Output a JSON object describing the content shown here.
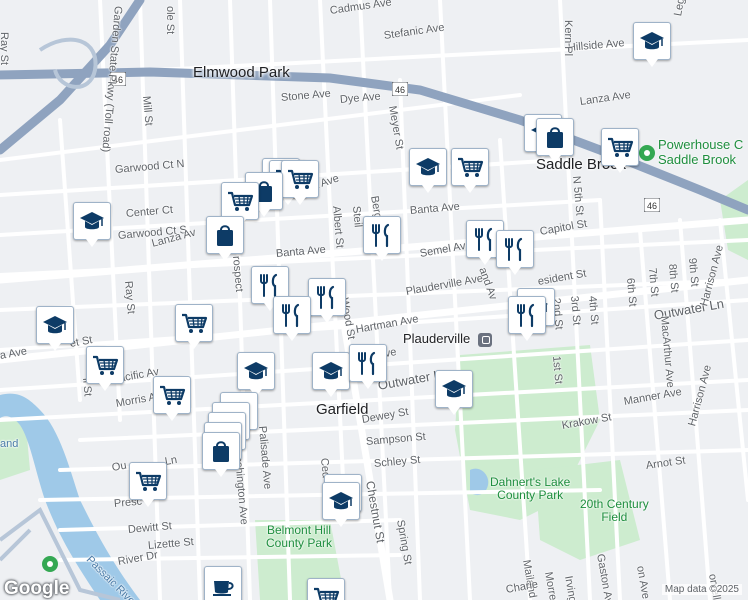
{
  "map": {
    "places": {
      "elmwood_park": "Elmwood Park",
      "saddle_brook": "Saddle Brook",
      "garfield": "Garfield",
      "plauderville": "Plauderville"
    },
    "parks": {
      "belmont_hill": "Belmont Hill\nCounty Park",
      "dahnerts_lake": "Dahnert's Lake\nCounty Park",
      "twentieth_century": "20th Century\nField"
    },
    "poi": {
      "powerhouse": "Powerhouse C\nSaddle Brook"
    },
    "route_number": "46",
    "streets": {
      "garden_state_pkwy": "Garden State Pkwy (Toll road)",
      "cadmus_ave": "Cadmus Ave",
      "stefanic_ave": "Stefanic Ave",
      "hillside_ave": "Hillside Ave",
      "kern_pl": "Kern Pl",
      "legregni": "Legregni",
      "ray_st_top": "Ray St",
      "stone_ave": "Stone Ave",
      "dye_ave": "Dye Ave",
      "mill_st": "Mill St",
      "lanza_ave_ne": "Lanza Ave",
      "meyer_st": "Meyer St",
      "garwood_ct_n": "Garwood Ct N",
      "center_ct": "Center Ct",
      "garwood_ct_s": "Garwood Ct S",
      "lanza_ave_main": "Lanza Ave",
      "lanza_ave_w": "Lanza Av",
      "albert_st": "Albert St",
      "steil_st": "Steil",
      "berge_st": "Berge",
      "banta_ave_e": "Banta Ave",
      "banta_ave_w": "Banta Ave",
      "semel_ave": "Semel Ave",
      "capitol_st": "Capitol St",
      "n5th_st": "N 5th St",
      "prospect_st": "rospect",
      "ray_st_mid": "Ray St",
      "plauderville_ave": "Plauderville Ave",
      "midland_ave": "and Av",
      "president_st": "esident St",
      "second_st": "2nd St",
      "fourth_st": "4th St",
      "sixth_st": "6th St",
      "seventh_st": "7th St",
      "eighth_st": "8th St",
      "ninth_st": "9th St",
      "outwater_ln_e": "Outwater Ln",
      "macarthur_ave": "MacArthur Ave",
      "harrison_ave": "Harrison Ave",
      "harrison_ave_s": "Harrison Ave",
      "hartman_ave": "Hartman Ave",
      "wood_st": "Wood St",
      "first_st": "1st St",
      "third_st": "3rd St",
      "a_ave": "a Ave",
      "et_st": "et St",
      "pacific_ave": "Pacific Av",
      "morris_ave": "Morris A",
      "ave_stub": "ve",
      "outwater_ln_mid": "Outwater L",
      "dewey_st": "Dewey St",
      "sampson_st": "Sampson St",
      "schley_st": "Schley St",
      "krakow_st": "Krakow St",
      "manner_ave": "Manner Ave",
      "arnot_st": "Arnot St",
      "palisade_ave": "Palisade Ave",
      "ashington_ave": "ashington Ave",
      "chestnut_st": "Chestnut St",
      "cedar_st": "Ced",
      "spring_st": "Spring St",
      "outwater_ln_w": "Ou",
      "outwater_ln_w2": "Ln",
      "presc": "Presc",
      "dewitt_st": "Dewitt St",
      "lizette_st": "Lizette St",
      "river_dr": "River Dr",
      "passaic_river": "Passaic River",
      "mailand_pl": "Mailand Pl",
      "morrell_pl": "Morrell Pl",
      "irving_pl": "Irving Pl",
      "gaston_ave": "Gaston Ave",
      "charle": "Charle",
      "on_ave": "on Ave",
      "orvell_pl": "orvell Pl",
      "cole_st": "ole St",
      "mill_st_w": "ll St",
      "and_label": "and",
      "side_st": "Side Ave"
    }
  },
  "markers": [
    {
      "icon": "school",
      "name": "school-marker"
    },
    {
      "icon": "grocery",
      "name": "grocery-marker"
    },
    {
      "icon": "shopping-bag",
      "name": "shopping-bag-marker"
    },
    {
      "icon": "restaurant",
      "name": "restaurant-marker"
    },
    {
      "icon": "cafe",
      "name": "cafe-marker"
    }
  ],
  "attribution": {
    "google": "Google",
    "map_data": "Map data ©2025"
  },
  "colors": {
    "background": "#eef0f3",
    "road": "#ffffff",
    "highway": "#8fa3bf",
    "water": "#9fc9e8",
    "park": "#cdeccf",
    "marker_icon": "#0d3b66",
    "park_text": "#1e8e3e"
  }
}
